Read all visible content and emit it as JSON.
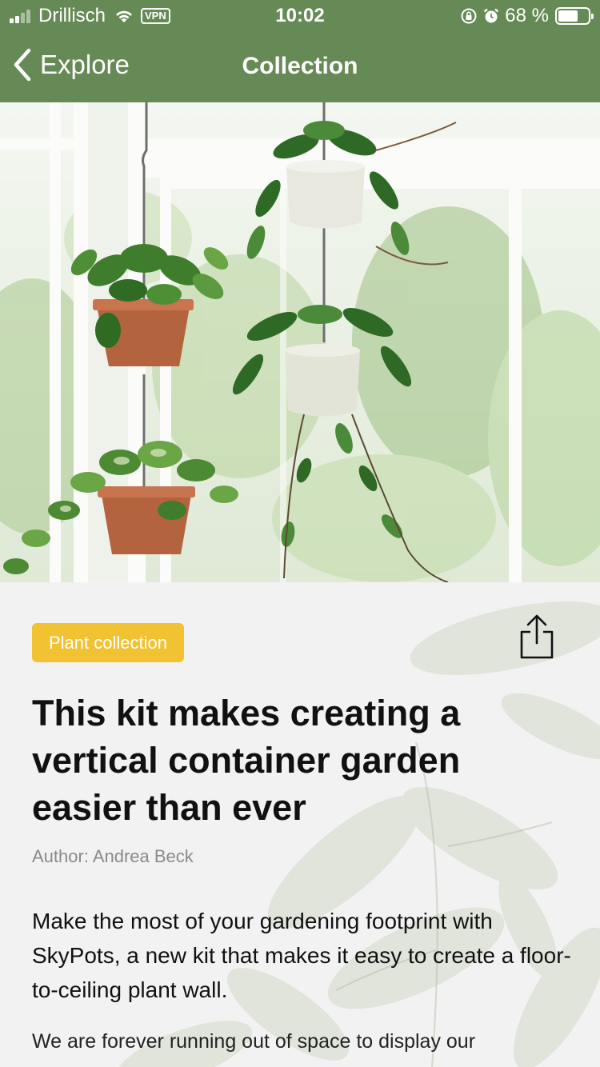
{
  "status_bar": {
    "carrier": "Drillisch",
    "vpn": "VPN",
    "time": "10:02",
    "battery_percent": "68 %",
    "battery_level": 0.68
  },
  "nav": {
    "back_label": "Explore",
    "title": "Collection"
  },
  "article": {
    "tag": "Plant collection",
    "headline": "This kit makes creating a vertical container garden easier than ever",
    "author": "Author: Andrea Beck",
    "lead": "Make the most of your gardening footprint with SkyPots, a new kit that makes it easy to create a floor-to-ceiling plant wall.",
    "body": "We are forever running out of space to display our"
  },
  "colors": {
    "nav_green": "#668a55",
    "tag_yellow": "#f1c232",
    "background": "#f2f2f2"
  }
}
